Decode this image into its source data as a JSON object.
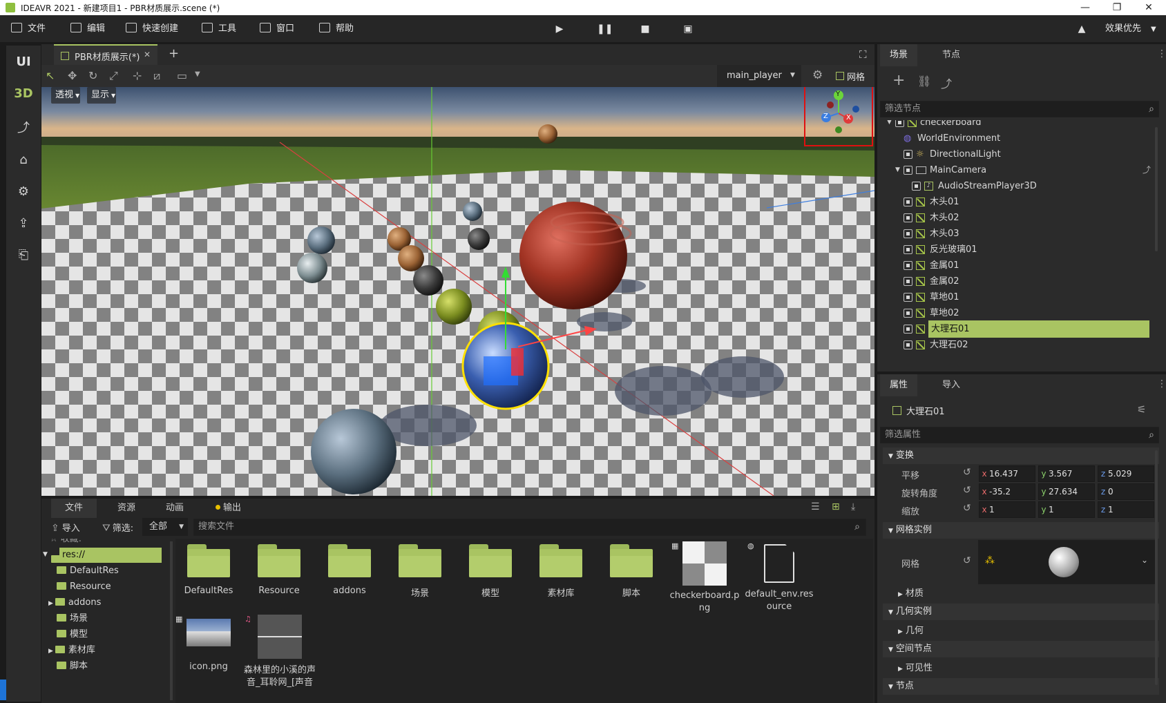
{
  "titlebar": {
    "title": "IDEAVR 2021 - 新建项目1 - PBR材质展示.scene (*)",
    "minimize": "—",
    "maximize": "❐",
    "close": "✕"
  },
  "menu": {
    "file": "文件",
    "edit": "编辑",
    "quick_create": "快速创建",
    "tools": "工具",
    "window": "窗口",
    "help": "帮助",
    "quality": "效果优先"
  },
  "left_tools": {
    "ui": "UI",
    "three_d": "3D"
  },
  "viewport": {
    "tab_label": "PBR材质展示(*)",
    "tab_close": "✕",
    "tab_add": "+",
    "camera_select": "main_player",
    "grid_label": "网格",
    "perspective_btn": "透视",
    "display_btn": "显示",
    "gizmo": {
      "y": "Y",
      "x": "X",
      "z": "Z"
    }
  },
  "scene_panel": {
    "tab_scene": "场景",
    "tab_node": "节点",
    "filter_placeholder": "筛选节点",
    "nodes": [
      {
        "label": "checkerboard"
      },
      {
        "label": "WorldEnvironment"
      },
      {
        "label": "DirectionalLight"
      },
      {
        "label": "MainCamera"
      },
      {
        "label": "AudioStreamPlayer3D"
      },
      {
        "label": "木头01"
      },
      {
        "label": "木头02"
      },
      {
        "label": "木头03"
      },
      {
        "label": "反光玻璃01"
      },
      {
        "label": "金属01"
      },
      {
        "label": "金属02"
      },
      {
        "label": "草地01"
      },
      {
        "label": "草地02"
      },
      {
        "label": "大理石01"
      },
      {
        "label": "大理石02"
      }
    ]
  },
  "inspector": {
    "tab_properties": "属性",
    "tab_import": "导入",
    "node_name": "大理石01",
    "filter_placeholder": "筛选属性",
    "transform_section": "变换",
    "translation_label": "平移",
    "rotation_label": "旋转角度",
    "scale_label": "缩放",
    "translation": {
      "x": "16.437",
      "y": "3.567",
      "z": "5.029"
    },
    "rotation": {
      "x": "-35.2",
      "y": "27.634",
      "z": "0"
    },
    "scale": {
      "x": "1",
      "y": "1",
      "z": "1"
    },
    "axis_x": "x",
    "axis_y": "y",
    "axis_z": "z",
    "mesh_instance_section": "网格实例",
    "mesh_label": "网格",
    "material_section": "材质",
    "geometry_instance_section": "几何实例",
    "geometry_section": "几何",
    "spatial_section": "空间节点",
    "visibility_section": "可见性",
    "node_section": "节点"
  },
  "file_dock": {
    "tab_files": "文件",
    "tab_resources": "资源",
    "tab_animation": "动画",
    "tab_output": "输出",
    "import_btn": "导入",
    "filter_label": "筛选:",
    "filter_value": "全部",
    "search_placeholder": "搜索文件",
    "favorites": "收藏:",
    "tree": [
      {
        "label": "res://"
      },
      {
        "label": "DefaultRes"
      },
      {
        "label": "Resource"
      },
      {
        "label": "addons"
      },
      {
        "label": "场景"
      },
      {
        "label": "模型"
      },
      {
        "label": "素材库"
      },
      {
        "label": "脚本"
      }
    ],
    "items": [
      {
        "label": "DefaultRes"
      },
      {
        "label": "Resource"
      },
      {
        "label": "addons"
      },
      {
        "label": "场景"
      },
      {
        "label": "模型"
      },
      {
        "label": "素材库"
      },
      {
        "label": "脚本"
      },
      {
        "label": "checkerboard.png"
      },
      {
        "label": "default_env.resource"
      },
      {
        "label": "icon.png"
      },
      {
        "label": "森林里的小溪的声音_耳聆网_[声音"
      }
    ]
  }
}
